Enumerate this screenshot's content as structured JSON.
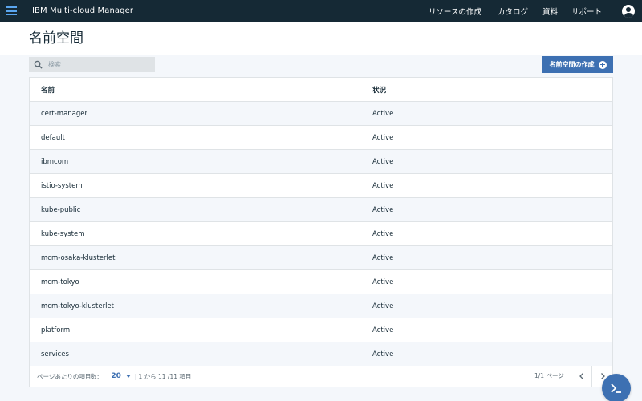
{
  "header": {
    "app_title": "IBM Multi-cloud Manager",
    "nav": [
      "リソースの作成",
      "カタログ",
      "資料",
      "サポート"
    ]
  },
  "page": {
    "title": "名前空間"
  },
  "toolbar": {
    "search_placeholder": "検索",
    "create_label": "名前空間の作成"
  },
  "table": {
    "columns": [
      "名前",
      "状況"
    ],
    "rows": [
      {
        "name": "cert-manager",
        "status": "Active"
      },
      {
        "name": "default",
        "status": "Active"
      },
      {
        "name": "ibmcom",
        "status": "Active"
      },
      {
        "name": "istio-system",
        "status": "Active"
      },
      {
        "name": "kube-public",
        "status": "Active"
      },
      {
        "name": "kube-system",
        "status": "Active"
      },
      {
        "name": "mcm-osaka-klusterlet",
        "status": "Active"
      },
      {
        "name": "mcm-tokyo",
        "status": "Active"
      },
      {
        "name": "mcm-tokyo-klusterlet",
        "status": "Active"
      },
      {
        "name": "platform",
        "status": "Active"
      },
      {
        "name": "services",
        "status": "Active"
      }
    ]
  },
  "pagination": {
    "per_page_label": "ページあたりの項目数:",
    "per_page": "20",
    "separator": "|",
    "range": "1 から 11 /11 項目",
    "page_info": "1/1 ページ"
  },
  "icons": {
    "menu": "hamburger-icon",
    "user": "user-avatar-icon",
    "search": "search-icon",
    "add": "add-circle-icon",
    "prev": "chevron-left-icon",
    "next": "chevron-right-icon",
    "terminal": "terminal-icon"
  },
  "colors": {
    "topbar": "#152935",
    "accent": "#3d70b2",
    "background": "#f4f7fb"
  }
}
